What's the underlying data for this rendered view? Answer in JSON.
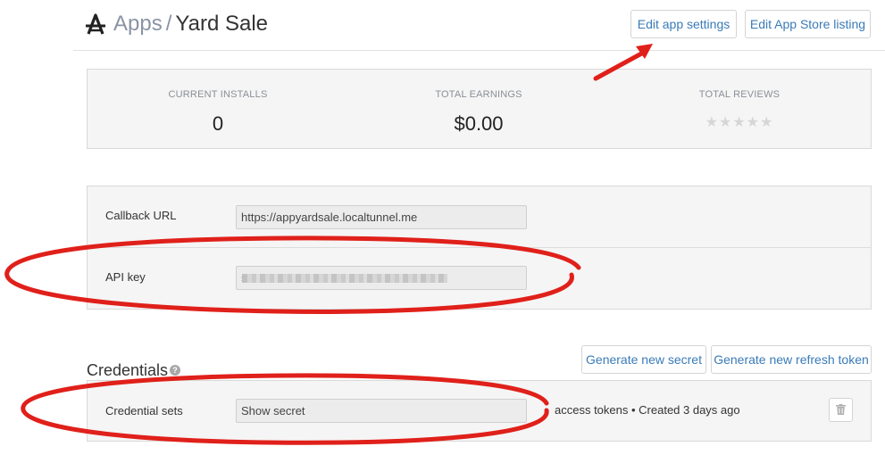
{
  "header": {
    "breadcrumb_root": "Apps",
    "breadcrumb_separator": "/",
    "app_name": "Yard Sale",
    "edit_settings_label": "Edit app settings",
    "edit_listing_label": "Edit App Store listing"
  },
  "stats": {
    "installs_label": "CURRENT INSTALLS",
    "installs_value": "0",
    "earnings_label": "TOTAL EARNINGS",
    "earnings_value": "$0.00",
    "reviews_label": "TOTAL REVIEWS",
    "reviews_stars": "★★★★★",
    "reviews_rating": 0
  },
  "settings": {
    "callback_label": "Callback URL",
    "callback_value": "https://appyardsale.localtunnel.me",
    "api_key_label": "API key",
    "api_key_value": "s"
  },
  "credentials": {
    "title": "Credentials",
    "help_glyph": "?",
    "generate_secret_label": "Generate new secret",
    "generate_refresh_label": "Generate new refresh token",
    "sets_label": "Credential sets",
    "show_secret_value": "Show secret",
    "meta_text": "access tokens • Created 3 days ago"
  },
  "icons": {
    "logo": "app-store-logo-icon",
    "help": "question-circle-icon",
    "trash": "trash-icon"
  },
  "colors": {
    "link": "#3a7bb8",
    "annotation": "#e0201a",
    "muted_text": "#8a94a6"
  }
}
